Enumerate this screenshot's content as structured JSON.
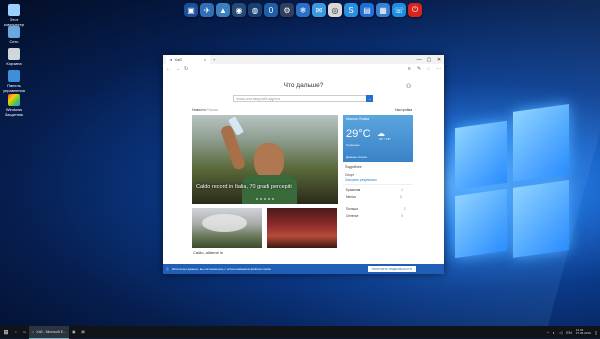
{
  "desktop": {
    "icons": [
      {
        "label": "Этот компьютер"
      },
      {
        "label": "Сеть"
      },
      {
        "label": "Корзина"
      },
      {
        "label": "Панель управления"
      },
      {
        "label": "Windows Защитник"
      }
    ]
  },
  "dock": {
    "items": [
      "folder",
      "bird",
      "photos",
      "eye",
      "globe",
      "circle",
      "settings",
      "network",
      "mail",
      "firefox",
      "skype",
      "calendar",
      "files",
      "phone",
      "power"
    ]
  },
  "browser": {
    "tab_title": "Хаб",
    "question": "Что дальше?",
    "search_placeholder": "поиск или ввод веб-адреса",
    "search_button": "→",
    "nav_label": "Новости",
    "nav_sub": "Россия",
    "nav_right": "Настройка",
    "hero_caption": "Caldo record in Italia, 70 gradi percepiti",
    "weather": {
      "location": "Moscow, Russia",
      "temp": "29°C",
      "condition": "Солнечно",
      "hi_lo": "31° / 18°",
      "source": "Данные: foreca",
      "link": "Подробнее"
    },
    "side_links": [
      "Спорт",
      "Смотреть результаты"
    ],
    "scores": [
      {
        "team": "Бразилия",
        "score": "1"
      },
      {
        "team": "Mexico",
        "score": "0"
      },
      {
        "team": "Польша",
        "score": "2"
      },
      {
        "team": "Сенегал",
        "score": "0"
      }
    ],
    "thumb_left_title": "Caldo, allarme in",
    "cookie_text": "Используя данные, вы соглашаетесь с использованием файлов cookie",
    "cookie_button": "ПОЛУЧИТЬ ПОДРОБНОСТИ"
  },
  "taskbar": {
    "start": "⊞",
    "items": [
      {
        "label": "Хаб - Microsoft E...",
        "active": true
      },
      {
        "label": "",
        "active": false
      }
    ],
    "time": "12:34",
    "date": "27.06.2019"
  }
}
